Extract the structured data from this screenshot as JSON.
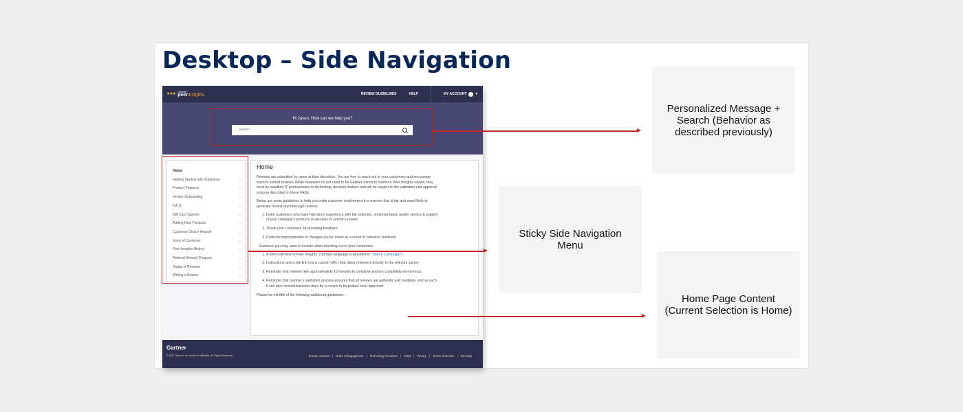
{
  "slide": {
    "title": "Desktop – Side Navigation"
  },
  "mockup": {
    "header": {
      "logo_top": "Gartner",
      "logo_main": "peer",
      "logo_accent": "insights.",
      "links": [
        "REVIEW GUIDELINES",
        "HELP"
      ],
      "account_label": "MY ACCOUNT"
    },
    "hero": {
      "greeting": "Hi Jason, How can we help you?",
      "search_placeholder": "Search"
    },
    "sidebar": {
      "items": [
        {
          "label": "Home",
          "expandable": false
        },
        {
          "label": "Getting Started with Guidelines",
          "expandable": true
        },
        {
          "label": "Product Features",
          "expandable": true
        },
        {
          "label": "Vendor Onboarding",
          "expandable": true
        },
        {
          "label": "F.A.Q",
          "expandable": true
        },
        {
          "label": "Gift Card Queries",
          "expandable": true
        },
        {
          "label": "Adding New Products",
          "expandable": true
        },
        {
          "label": "Customer Choice Awards",
          "expandable": true
        },
        {
          "label": "Voice of Customer",
          "expandable": true
        },
        {
          "label": "Peer Insights History",
          "expandable": true
        },
        {
          "label": "Referral Reward Program",
          "expandable": true
        },
        {
          "label": "Status of Reviews",
          "expandable": true
        },
        {
          "label": "Writing a Review",
          "expandable": true
        }
      ]
    },
    "content": {
      "title": "Home",
      "para1": "Reviews are submitted by users at their discretion. You are free to reach out to your customers and encourage them to submit reviews. While reviewers do not need to be Gartner clients to submit a Peer Insights review, they must be qualified IT professionals or technology decision makers and will be subject to the validation and approval process described in these FAQs.",
      "para2": "Below are some guidelines to help you invite customer involvement in a manner that is fair and most likely to generate honest and thorough reviews:",
      "list1": [
        "Invite customers who have had direct experience with the selection, implementation and/or service & support of your company's products or services to submit a review",
        "Thank your customers for providing feedback",
        "Publicize improvements or changes you've made as a result of customer feedback"
      ],
      "para3": "Guidance you may want to include when reaching out to your customers:",
      "list2_item1_prefix": "A brief overview of Peer Insights. (Sample language is provided in \"",
      "list2_item1_link": "Start a Campaign",
      "list2_item1_suffix": "\").",
      "list2_rest": [
        "Instructions and a site link (via a custom URL) that takes reviewers directly to the relevant survey.",
        "Reminder that reviews take approximately 10 minutes to complete and are completely anonymous.",
        "Reminder that Gartner's validation process ensures that all reviews are authentic and readable, and as such it can take several business days for a review to be posted once approved."
      ],
      "para4": "Please be mindful of the following additional guidelines:"
    },
    "footer": {
      "logo": "Gartner",
      "copyright": "© 2017 Gartner, Inc. and/or its Affiliates. All Rights Reserved.",
      "links": [
        "Browse Vendors",
        "|",
        "Rules of Engagement",
        "|",
        "Technology Providers",
        "|",
        "FAQs",
        "|",
        "Privacy",
        "|",
        "Terms of Service",
        "|",
        "Site Map"
      ]
    }
  },
  "callouts": {
    "search": "Personalized Message + Search (Behavior as described previously)",
    "sidebar": "Sticky Side Navigation Menu",
    "content": "Home Page Content (Current Selection is Home)"
  },
  "colors": {
    "annotation_red": "#c0272d",
    "title_navy": "#0b2756",
    "hero": "#494873",
    "header": "#2f2f4f"
  }
}
